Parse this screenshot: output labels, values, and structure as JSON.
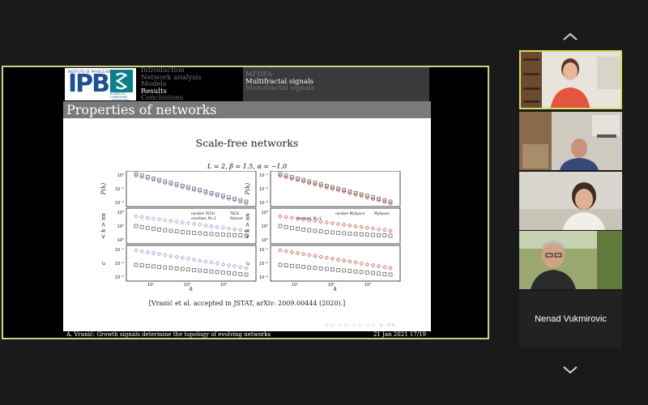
{
  "slide": {
    "header": {
      "logos": {
        "ipb_caption": "INSTITUTE OF PHYSICS BELGRADE",
        "ipb_mark": "IPB",
        "scl_caption": "SCIENTIFIC COMPUTING LABORATORY"
      },
      "sections": [
        "Introduction",
        "Network analysis",
        "Models",
        "Results",
        "Conclusions"
      ],
      "active_section": "Results",
      "subsections": [
        "MFDFA",
        "Multifractal signals",
        "Monofractal signals"
      ],
      "active_subsection": "Multifractal signals"
    },
    "frame_title": "Properties of networks",
    "subtitle": "Scale-free networks",
    "figure_params": "L = 2, β = 1.5, α = −1.0",
    "citation": "[Vranić et al. accepted in JSTAT, arXiv: 2009.00444 (2020).]",
    "footer": {
      "left": "A. Vranić: Growth signals determine the topology of evolving networks",
      "right": "21 Jan 2021   17/19"
    },
    "beamer_nav": "◁ ▷ ◁ ▷ ◁ ▷ ◁ ▷ ≡ ↺↻"
  },
  "chart_data": [
    {
      "type": "scatter",
      "panel": "left-top",
      "ylabel": "P(k)",
      "yscale": "log",
      "ytick_labels": [
        "10⁰",
        "10⁻²",
        "10⁻³"
      ]
    },
    {
      "type": "scatter",
      "panel": "left-middle",
      "ylabel": "< k > nn",
      "yscale": "log",
      "ytick_labels": [
        "10³",
        "10²",
        "10¹"
      ],
      "legend": [
        "random TECH",
        "TECH",
        "constant, M=1",
        "Poisson"
      ]
    },
    {
      "type": "scatter",
      "panel": "left-bottom",
      "ylabel": "c",
      "yscale": "log",
      "xlabel": "k",
      "xscale": "log",
      "ytick_labels": [
        "10⁻¹",
        "10⁻²",
        "10⁻³"
      ],
      "xtick_labels": [
        "10¹",
        "10²",
        "10³"
      ]
    },
    {
      "type": "scatter",
      "panel": "right-top",
      "ylabel": "P(k)",
      "yscale": "log",
      "ytick_labels": [
        "10⁻¹",
        "10⁻⁴",
        "10⁻⁵"
      ]
    },
    {
      "type": "scatter",
      "panel": "right-middle",
      "ylabel": "< k > nn",
      "yscale": "log",
      "ytick_labels": [
        "10³",
        "10²",
        "10¹"
      ],
      "legend": [
        "random MySpace",
        "MySpace",
        "constant, M=1"
      ]
    },
    {
      "type": "scatter",
      "panel": "right-bottom",
      "ylabel": "c",
      "yscale": "log",
      "xlabel": "k",
      "xscale": "log",
      "ytick_labels": [
        "10⁻¹",
        "10⁻²",
        "10⁻³"
      ],
      "xtick_labels": [
        "10¹",
        "10²",
        "10³"
      ]
    }
  ],
  "participants": [
    {
      "name": "",
      "speaking": true
    },
    {
      "name": "",
      "speaking": false
    },
    {
      "name": "",
      "speaking": false
    },
    {
      "name": "",
      "speaking": false
    },
    {
      "name": "Nenad Vukmirovic",
      "speaking": false,
      "video": false
    }
  ],
  "gallery_controls": {
    "up_icon": "chevron-up-icon",
    "down_icon": "chevron-down-icon"
  },
  "colors": {
    "active_speaker_border": "#d4e05a",
    "share_border": "#c8d28a",
    "background": "#1a1a1a"
  }
}
